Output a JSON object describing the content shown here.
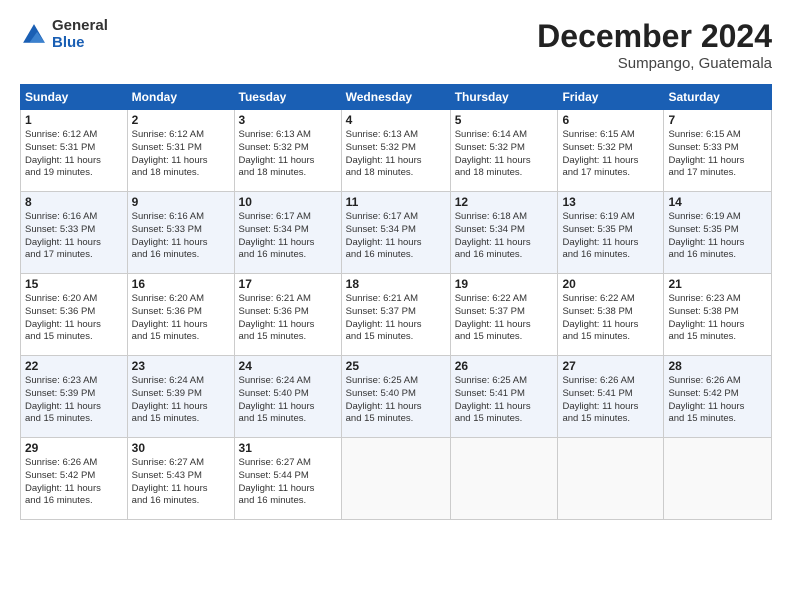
{
  "header": {
    "logo_general": "General",
    "logo_blue": "Blue",
    "title": "December 2024",
    "subtitle": "Sumpango, Guatemala"
  },
  "days_of_week": [
    "Sunday",
    "Monday",
    "Tuesday",
    "Wednesday",
    "Thursday",
    "Friday",
    "Saturday"
  ],
  "weeks": [
    [
      {
        "day": 1,
        "info": "Sunrise: 6:12 AM\nSunset: 5:31 PM\nDaylight: 11 hours\nand 19 minutes."
      },
      {
        "day": 2,
        "info": "Sunrise: 6:12 AM\nSunset: 5:31 PM\nDaylight: 11 hours\nand 18 minutes."
      },
      {
        "day": 3,
        "info": "Sunrise: 6:13 AM\nSunset: 5:32 PM\nDaylight: 11 hours\nand 18 minutes."
      },
      {
        "day": 4,
        "info": "Sunrise: 6:13 AM\nSunset: 5:32 PM\nDaylight: 11 hours\nand 18 minutes."
      },
      {
        "day": 5,
        "info": "Sunrise: 6:14 AM\nSunset: 5:32 PM\nDaylight: 11 hours\nand 18 minutes."
      },
      {
        "day": 6,
        "info": "Sunrise: 6:15 AM\nSunset: 5:32 PM\nDaylight: 11 hours\nand 17 minutes."
      },
      {
        "day": 7,
        "info": "Sunrise: 6:15 AM\nSunset: 5:33 PM\nDaylight: 11 hours\nand 17 minutes."
      }
    ],
    [
      {
        "day": 8,
        "info": "Sunrise: 6:16 AM\nSunset: 5:33 PM\nDaylight: 11 hours\nand 17 minutes."
      },
      {
        "day": 9,
        "info": "Sunrise: 6:16 AM\nSunset: 5:33 PM\nDaylight: 11 hours\nand 16 minutes."
      },
      {
        "day": 10,
        "info": "Sunrise: 6:17 AM\nSunset: 5:34 PM\nDaylight: 11 hours\nand 16 minutes."
      },
      {
        "day": 11,
        "info": "Sunrise: 6:17 AM\nSunset: 5:34 PM\nDaylight: 11 hours\nand 16 minutes."
      },
      {
        "day": 12,
        "info": "Sunrise: 6:18 AM\nSunset: 5:34 PM\nDaylight: 11 hours\nand 16 minutes."
      },
      {
        "day": 13,
        "info": "Sunrise: 6:19 AM\nSunset: 5:35 PM\nDaylight: 11 hours\nand 16 minutes."
      },
      {
        "day": 14,
        "info": "Sunrise: 6:19 AM\nSunset: 5:35 PM\nDaylight: 11 hours\nand 16 minutes."
      }
    ],
    [
      {
        "day": 15,
        "info": "Sunrise: 6:20 AM\nSunset: 5:36 PM\nDaylight: 11 hours\nand 15 minutes."
      },
      {
        "day": 16,
        "info": "Sunrise: 6:20 AM\nSunset: 5:36 PM\nDaylight: 11 hours\nand 15 minutes."
      },
      {
        "day": 17,
        "info": "Sunrise: 6:21 AM\nSunset: 5:36 PM\nDaylight: 11 hours\nand 15 minutes."
      },
      {
        "day": 18,
        "info": "Sunrise: 6:21 AM\nSunset: 5:37 PM\nDaylight: 11 hours\nand 15 minutes."
      },
      {
        "day": 19,
        "info": "Sunrise: 6:22 AM\nSunset: 5:37 PM\nDaylight: 11 hours\nand 15 minutes."
      },
      {
        "day": 20,
        "info": "Sunrise: 6:22 AM\nSunset: 5:38 PM\nDaylight: 11 hours\nand 15 minutes."
      },
      {
        "day": 21,
        "info": "Sunrise: 6:23 AM\nSunset: 5:38 PM\nDaylight: 11 hours\nand 15 minutes."
      }
    ],
    [
      {
        "day": 22,
        "info": "Sunrise: 6:23 AM\nSunset: 5:39 PM\nDaylight: 11 hours\nand 15 minutes."
      },
      {
        "day": 23,
        "info": "Sunrise: 6:24 AM\nSunset: 5:39 PM\nDaylight: 11 hours\nand 15 minutes."
      },
      {
        "day": 24,
        "info": "Sunrise: 6:24 AM\nSunset: 5:40 PM\nDaylight: 11 hours\nand 15 minutes."
      },
      {
        "day": 25,
        "info": "Sunrise: 6:25 AM\nSunset: 5:40 PM\nDaylight: 11 hours\nand 15 minutes."
      },
      {
        "day": 26,
        "info": "Sunrise: 6:25 AM\nSunset: 5:41 PM\nDaylight: 11 hours\nand 15 minutes."
      },
      {
        "day": 27,
        "info": "Sunrise: 6:26 AM\nSunset: 5:41 PM\nDaylight: 11 hours\nand 15 minutes."
      },
      {
        "day": 28,
        "info": "Sunrise: 6:26 AM\nSunset: 5:42 PM\nDaylight: 11 hours\nand 15 minutes."
      }
    ],
    [
      {
        "day": 29,
        "info": "Sunrise: 6:26 AM\nSunset: 5:42 PM\nDaylight: 11 hours\nand 16 minutes."
      },
      {
        "day": 30,
        "info": "Sunrise: 6:27 AM\nSunset: 5:43 PM\nDaylight: 11 hours\nand 16 minutes."
      },
      {
        "day": 31,
        "info": "Sunrise: 6:27 AM\nSunset: 5:44 PM\nDaylight: 11 hours\nand 16 minutes."
      },
      null,
      null,
      null,
      null
    ]
  ]
}
